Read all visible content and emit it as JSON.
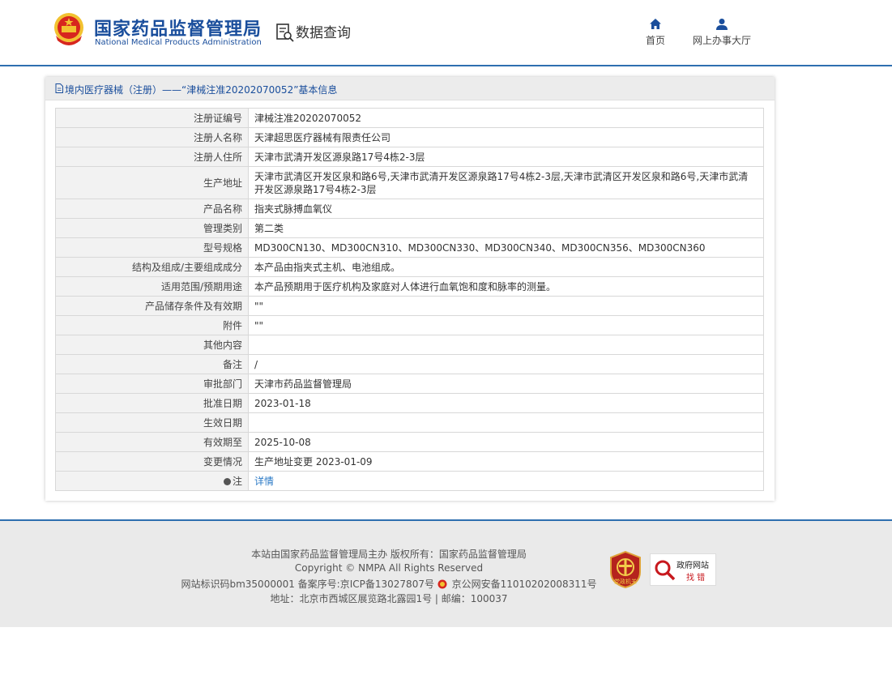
{
  "header": {
    "logo_cn": "国家药品监督管理局",
    "logo_en": "National Medical Products Administration",
    "section_title": "数据查询",
    "nav": [
      {
        "label": "首页",
        "icon": "home-icon"
      },
      {
        "label": "网上办事大厅",
        "icon": "user-icon"
      }
    ]
  },
  "panel": {
    "title": "境内医疗器械（注册）——“津械注准20202070052”基本信息"
  },
  "rows": [
    {
      "key": "注册证编号",
      "value": "津械注准20202070052"
    },
    {
      "key": "注册人名称",
      "value": "天津超思医疗器械有限责任公司"
    },
    {
      "key": "注册人住所",
      "value": "天津市武清开发区源泉路17号4栋2-3层"
    },
    {
      "key": "生产地址",
      "value": "天津市武清区开发区泉和路6号,天津市武清开发区源泉路17号4栋2-3层,天津市武清区开发区泉和路6号,天津市武清开发区源泉路17号4栋2-3层"
    },
    {
      "key": "产品名称",
      "value": "指夹式脉搏血氧仪"
    },
    {
      "key": "管理类别",
      "value": "第二类"
    },
    {
      "key": "型号规格",
      "value": "MD300CN130、MD300CN310、MD300CN330、MD300CN340、MD300CN356、MD300CN360"
    },
    {
      "key": "结构及组成/主要组成成分",
      "value": "本产品由指夹式主机、电池组成。"
    },
    {
      "key": "适用范围/预期用途",
      "value": "本产品预期用于医疗机构及家庭对人体进行血氧饱和度和脉率的测量。"
    },
    {
      "key": "产品储存条件及有效期",
      "value": "\"\""
    },
    {
      "key": "附件",
      "value": "\"\""
    },
    {
      "key": "其他内容",
      "value": ""
    },
    {
      "key": "备注",
      "value": "/"
    },
    {
      "key": "审批部门",
      "value": "天津市药品监督管理局"
    },
    {
      "key": "批准日期",
      "value": "2023-01-18"
    },
    {
      "key": "生效日期",
      "value": ""
    },
    {
      "key": "有效期至",
      "value": "2025-10-08"
    },
    {
      "key": "变更情况",
      "value": "生产地址变更 2023-01-09"
    }
  ],
  "note_row": {
    "key": "注",
    "link": "详情"
  },
  "footer": {
    "line1": "本站由国家药品监督管理局主办 版权所有：国家药品监督管理局",
    "line2": "Copyright © NMPA All Rights Reserved",
    "line3a": "网站标识码bm35000001    备案序号:京ICP备13027807号",
    "line3b": "京公网安备11010202008311号",
    "line4": "地址：北京市西城区展览路北露园1号 | 邮编：100037",
    "badge1_text": "党政机关",
    "badge2_top": "政府网站",
    "badge2_bottom": "找 错"
  },
  "colors": {
    "brand": "#1a4e9c",
    "link": "#2a79c6",
    "rule": "#2e6fb0"
  }
}
